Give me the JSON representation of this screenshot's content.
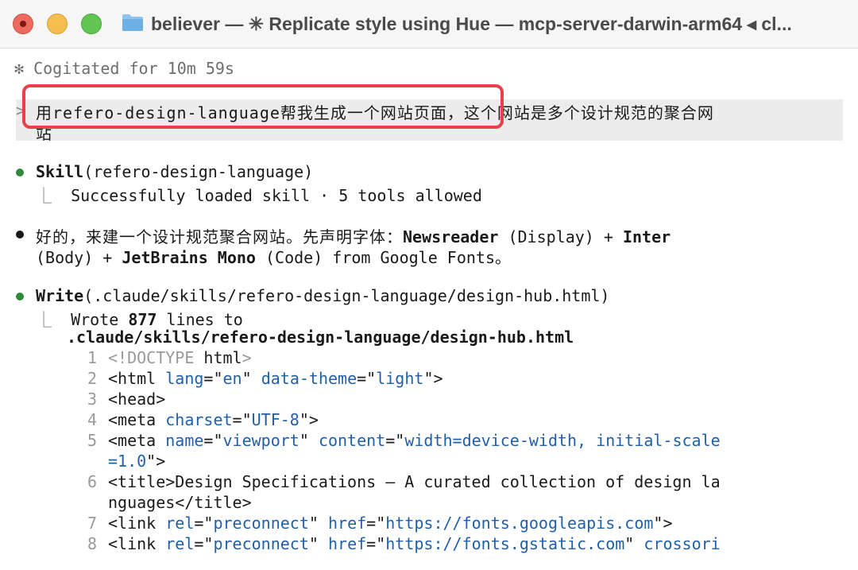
{
  "window": {
    "title": "believer — ✳ Replicate style using Hue — mcp-server-darwin-arm64 ◂ cl...",
    "colors": {
      "close": "#ed6a5e",
      "minimize": "#f5bf4f",
      "maximize": "#61c554",
      "prompt_highlight": "#e8414b",
      "tool_dot": "#2e8b3a",
      "code_attr": "#2060a8"
    }
  },
  "status": {
    "glyph": "✻",
    "text": "Cogitated for 10m 59s"
  },
  "prompt": {
    "chevron": ">",
    "line1": "用refero-design-language帮我生成一个网站页面，这个网站是多个设计规范的聚合网",
    "line2": "站"
  },
  "skill_call": {
    "name": "Skill",
    "args": "(refero-design-language)",
    "result_branch": "⎿",
    "result": "Successfully loaded skill · 5 tools allowed"
  },
  "reply": {
    "line1_prefix": "好的，来建一个设计规范聚合网站。先声明字体：",
    "font1": "Newsreader",
    "font1_note": " (Display) + ",
    "font2": "Inter",
    "line2_prefix": "(Body) + ",
    "font3": "JetBrains Mono",
    "line2_suffix": " (Code) from Google Fonts。"
  },
  "write_call": {
    "name": "Write",
    "args": "(.claude/skills/refero-design-language/design-hub.html)",
    "result_branch": "⎿",
    "result_prefix": "Wrote ",
    "line_count": "877",
    "result_suffix": " lines to",
    "path": ".claude/skills/refero-design-language/design-hub.html"
  },
  "code": [
    {
      "n": "1",
      "parts": [
        {
          "t": "<!DOCTYPE ",
          "c": "lightgray"
        },
        {
          "t": "html",
          "c": ""
        },
        {
          "t": ">",
          "c": "lightgray"
        }
      ]
    },
    {
      "n": "2",
      "parts": [
        {
          "t": "<html ",
          "c": ""
        },
        {
          "t": "lang",
          "c": "blue"
        },
        {
          "t": "=\"",
          "c": ""
        },
        {
          "t": "en",
          "c": "blue"
        },
        {
          "t": "\" ",
          "c": ""
        },
        {
          "t": "data-theme",
          "c": "blue"
        },
        {
          "t": "=\"",
          "c": ""
        },
        {
          "t": "light",
          "c": "blue"
        },
        {
          "t": "\">",
          "c": ""
        }
      ]
    },
    {
      "n": "3",
      "parts": [
        {
          "t": "<head>",
          "c": ""
        }
      ]
    },
    {
      "n": "4",
      "parts": [
        {
          "t": "<meta ",
          "c": ""
        },
        {
          "t": "charset",
          "c": "blue"
        },
        {
          "t": "=\"",
          "c": ""
        },
        {
          "t": "UTF-8",
          "c": "blue"
        },
        {
          "t": "\">",
          "c": ""
        }
      ]
    },
    {
      "n": "5",
      "parts": [
        {
          "t": "<meta ",
          "c": ""
        },
        {
          "t": "name",
          "c": "blue"
        },
        {
          "t": "=\"",
          "c": ""
        },
        {
          "t": "viewport",
          "c": "blue"
        },
        {
          "t": "\" ",
          "c": ""
        },
        {
          "t": "content",
          "c": "blue"
        },
        {
          "t": "=\"",
          "c": ""
        },
        {
          "t": "width=device-width, initial-scale",
          "c": "blue"
        }
      ]
    },
    {
      "n": "",
      "parts": [
        {
          "t": "=1.0",
          "c": "blue"
        },
        {
          "t": "\">",
          "c": ""
        }
      ]
    },
    {
      "n": "6",
      "parts": [
        {
          "t": "<title>Design Specifications — A curated collection of design la",
          "c": ""
        }
      ]
    },
    {
      "n": "",
      "parts": [
        {
          "t": "nguages</title>",
          "c": ""
        }
      ]
    },
    {
      "n": "7",
      "parts": [
        {
          "t": "<link ",
          "c": ""
        },
        {
          "t": "rel",
          "c": "blue"
        },
        {
          "t": "=\"",
          "c": ""
        },
        {
          "t": "preconnect",
          "c": "blue"
        },
        {
          "t": "\" ",
          "c": ""
        },
        {
          "t": "href",
          "c": "blue"
        },
        {
          "t": "=\"",
          "c": ""
        },
        {
          "t": "https://fonts.googleapis.com",
          "c": "blue"
        },
        {
          "t": "\">",
          "c": ""
        }
      ]
    },
    {
      "n": "8",
      "parts": [
        {
          "t": "<link ",
          "c": ""
        },
        {
          "t": "rel",
          "c": "blue"
        },
        {
          "t": "=\"",
          "c": ""
        },
        {
          "t": "preconnect",
          "c": "blue"
        },
        {
          "t": "\" ",
          "c": ""
        },
        {
          "t": "href",
          "c": "blue"
        },
        {
          "t": "=\"",
          "c": ""
        },
        {
          "t": "https://fonts.gstatic.com",
          "c": "blue"
        },
        {
          "t": "\" ",
          "c": ""
        },
        {
          "t": "crossori",
          "c": "blue"
        }
      ]
    }
  ]
}
